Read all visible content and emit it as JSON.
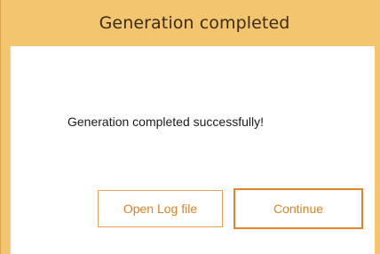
{
  "dialog": {
    "title": "Generation completed",
    "message": "Generation completed successfully!",
    "buttons": {
      "open_log": "Open Log file",
      "continue": "Continue"
    }
  },
  "colors": {
    "titlebar": "#f3c56e",
    "button_text": "#d98427",
    "button_border": "#e0852a"
  }
}
